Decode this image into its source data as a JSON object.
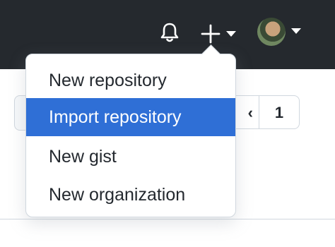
{
  "header": {
    "notifications_icon": "bell-icon",
    "create_icon": "plus-icon",
    "create_caret_icon": "chevron-down-icon",
    "avatar_caret_icon": "chevron-down-icon",
    "background_color": "#25292e"
  },
  "pagination": {
    "prev_label": "‹",
    "current_page": "1"
  },
  "create_menu": {
    "highlight_color": "#2f6fd6",
    "items": [
      {
        "label": "New repository",
        "active": false
      },
      {
        "label": "Import repository",
        "active": true
      },
      {
        "label": "New gist",
        "active": false
      },
      {
        "label": "New organization",
        "active": false
      }
    ]
  }
}
